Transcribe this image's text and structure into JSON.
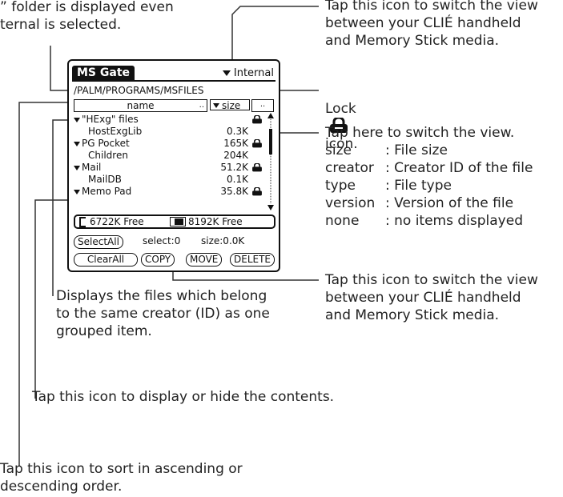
{
  "annotations": {
    "top_left_fragment": "” folder is displayed even\nternal is selected.",
    "switch_view_top": "Tap this icon to switch the view\nbetween your CLIÉ handheld\nand Memory Stick media.",
    "lock_icon_label_before": "Lock",
    "lock_icon_label_after": "icon.",
    "switch_view_mid": "Tap here to switch the view.",
    "view_options": [
      {
        "key": "size",
        "desc": ": File size"
      },
      {
        "key": "creator",
        "desc": ": Creator ID of the file"
      },
      {
        "key": "type",
        "desc": ": File type"
      },
      {
        "key": "version",
        "desc": ": Version of the file"
      },
      {
        "key": "none",
        "desc": ": no items displayed"
      }
    ],
    "switch_view_bottom": "Tap this icon to switch the view\nbetween your CLIÉ handheld\nand Memory Stick media.",
    "grouped_items": "Displays the files which belong\nto the same creator (ID) as one\ngrouped item.",
    "display_hide": "Tap this icon to display or hide the contents.",
    "sort_order": "Tap this icon to sort in ascending or\ndescending order."
  },
  "screen": {
    "app_title": "MS Gate",
    "location_dropdown": "Internal",
    "path": "/PALM/PROGRAMS/MSFILES",
    "column_name": "name",
    "column_name_dots": "..",
    "column_view": "size",
    "column_extra_dots": "..",
    "files": [
      {
        "name": "\"HExg\" files",
        "group": true,
        "value": "",
        "locked": true
      },
      {
        "name": "HostExgLib",
        "group": false,
        "value": "0.3K",
        "locked": false
      },
      {
        "name": "PG Pocket",
        "group": true,
        "value": "165K",
        "locked": true
      },
      {
        "name": "Children",
        "group": false,
        "value": "204K",
        "locked": false
      },
      {
        "name": "Mail",
        "group": true,
        "value": "51.2K",
        "locked": true
      },
      {
        "name": "MailDB",
        "group": false,
        "value": "0.1K",
        "locked": false
      },
      {
        "name": "Memo Pad",
        "group": true,
        "value": "35.8K",
        "locked": true
      }
    ],
    "free_ms": "6722K Free",
    "free_internal": "8192K Free",
    "select_all": "SelectAll",
    "select_count": "select:0",
    "size_total": "size:0.0K",
    "clear_all": "ClearAll",
    "copy": "COPY",
    "move": "MOVE",
    "delete": "DELETE"
  }
}
